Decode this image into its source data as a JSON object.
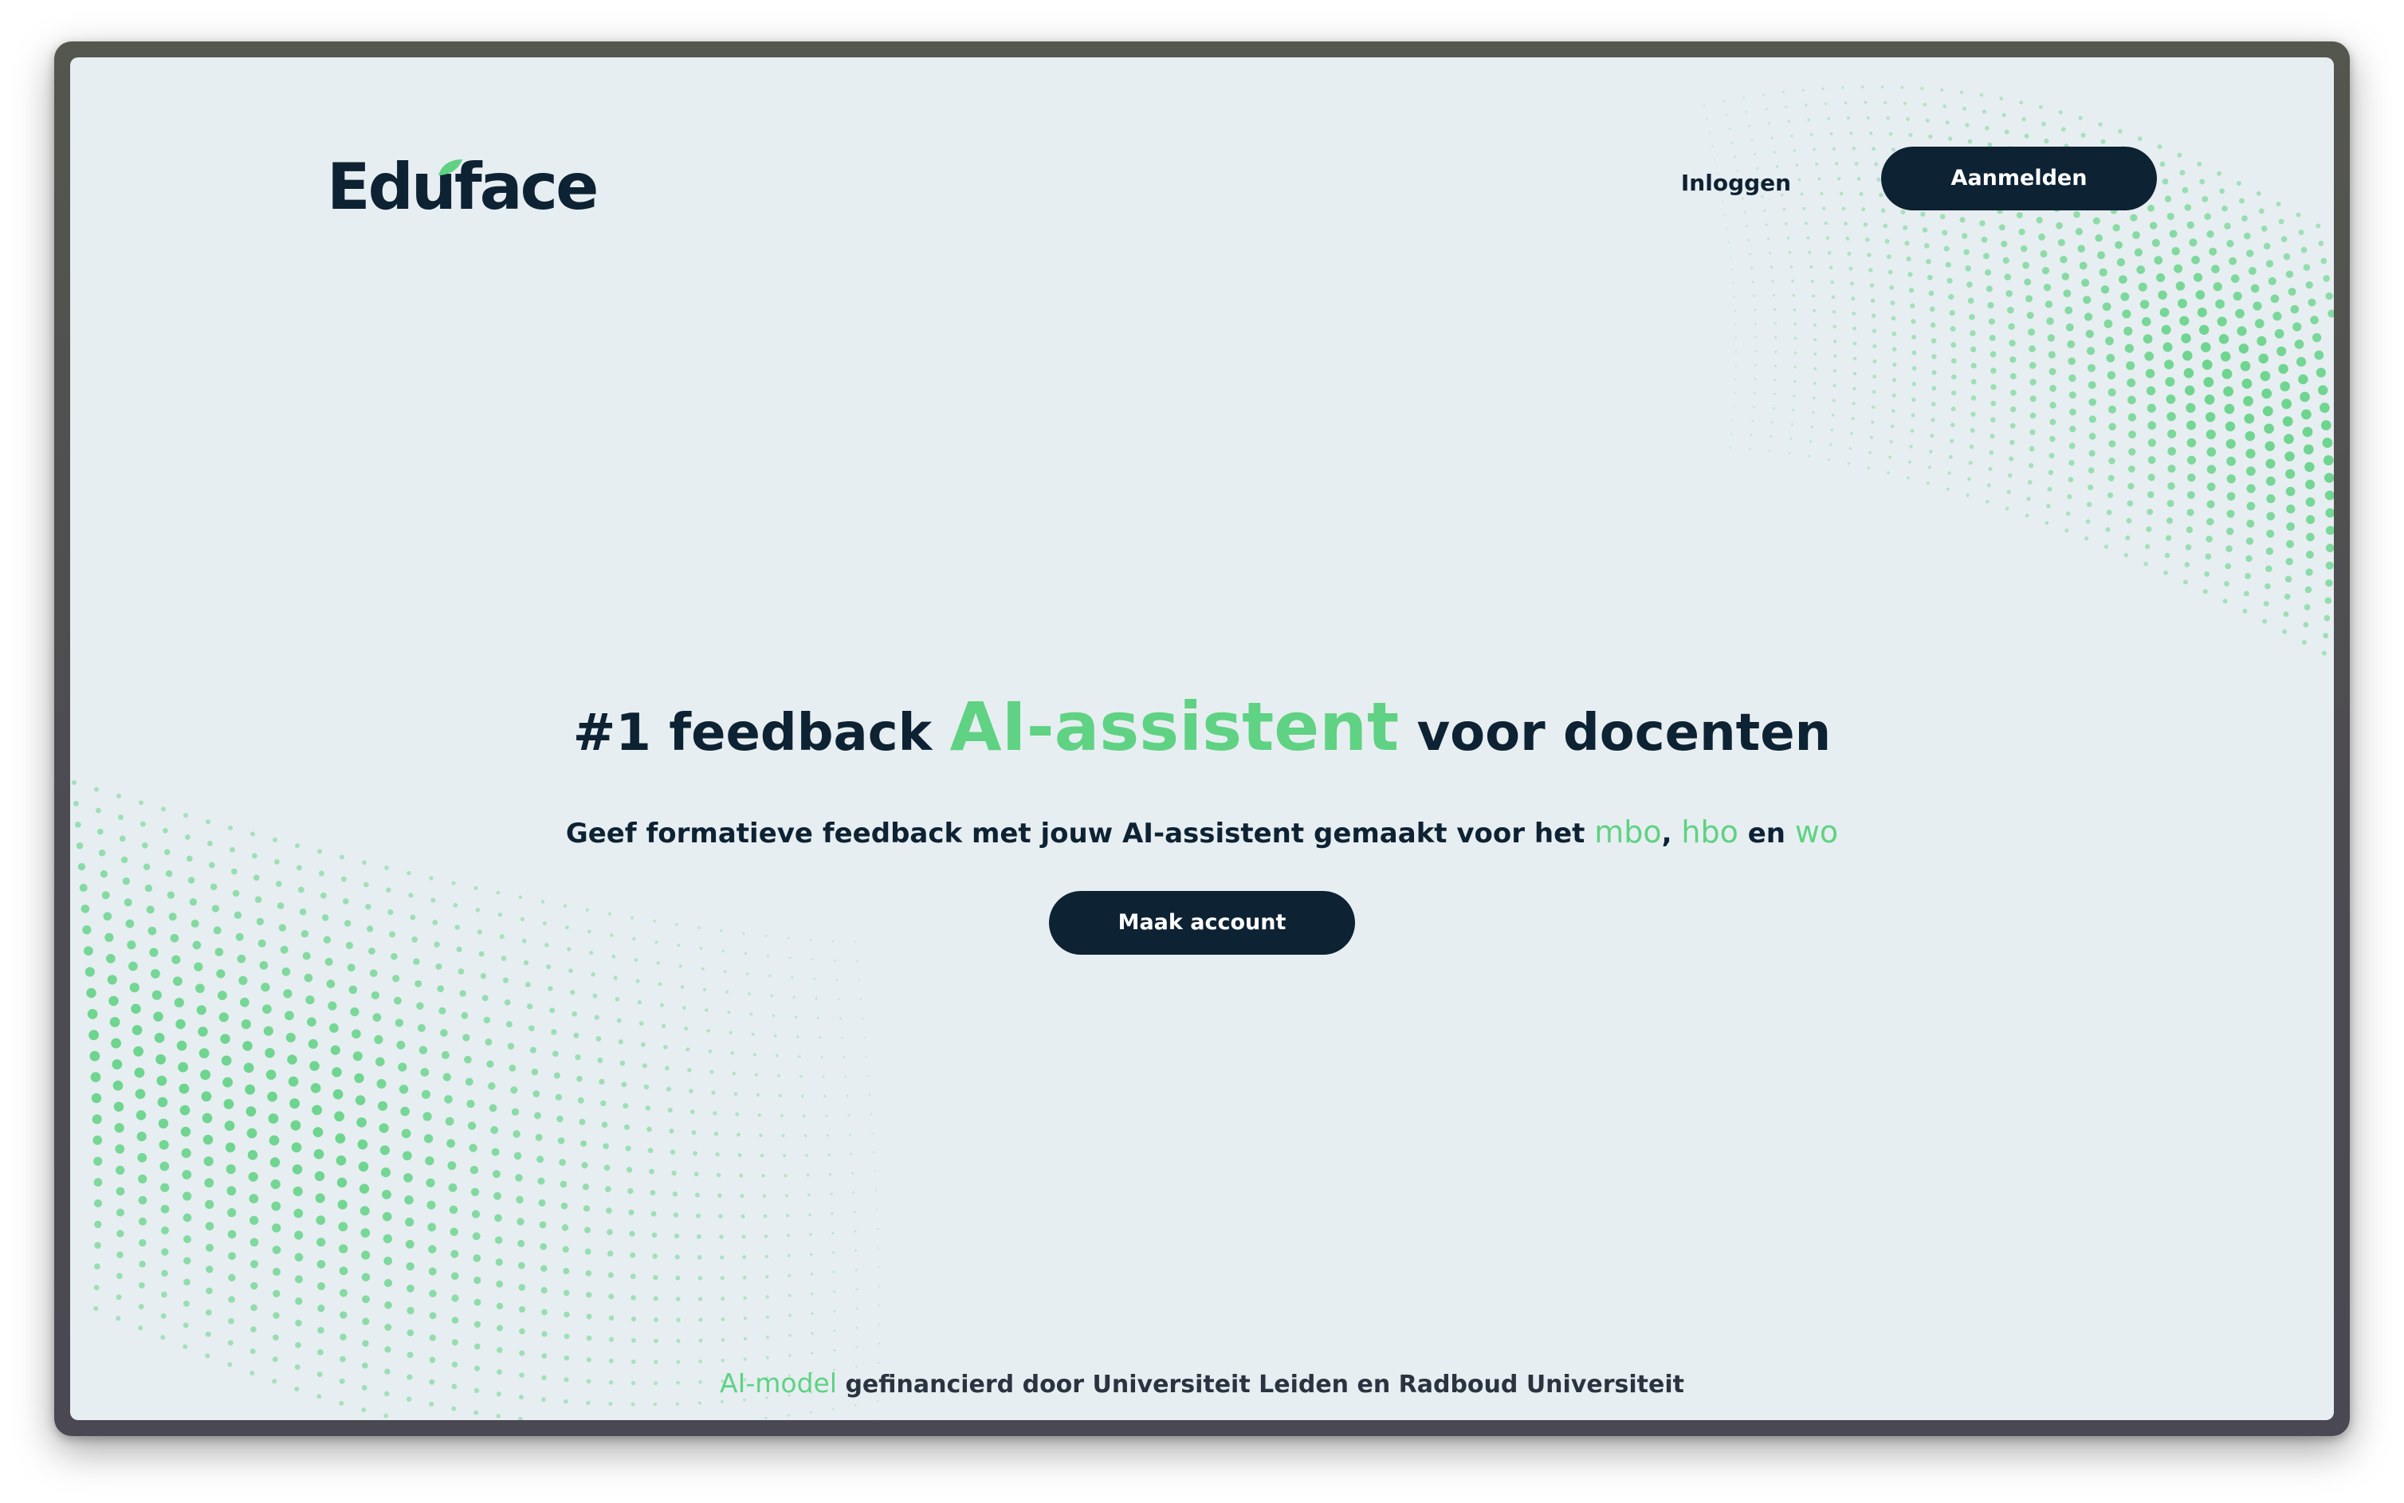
{
  "header": {
    "logo_text": "Eduface",
    "login_label": "Inloggen",
    "signup_label": "Aanmelden"
  },
  "hero": {
    "title_prefix": "#1 feedback ",
    "title_accent": "AI-assistent",
    "title_suffix": " voor docenten",
    "subtitle_prefix": "Geef formatieve feedback met jouw AI-assistent gemaakt voor het ",
    "level_1": "mbo",
    "sep_1": ", ",
    "level_2": "hbo",
    "sep_2": " en ",
    "level_3": "wo",
    "cta_label": "Maak account"
  },
  "footer": {
    "model_label": "AI-model",
    "funding_text": " gefinancierd door Universiteit Leiden en Radboud Universiteit"
  },
  "colors": {
    "navy": "#0d2233",
    "accent_green": "#5fd283",
    "background": "#e7eef1"
  },
  "icons": {
    "logo_leaf": "leaf-icon"
  }
}
